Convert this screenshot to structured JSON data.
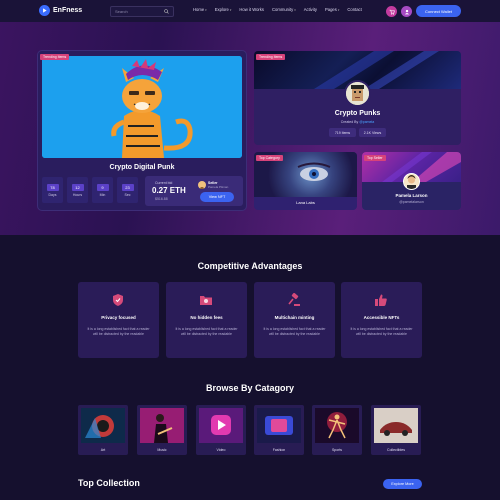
{
  "nav": {
    "brand": "EnFness",
    "search_placeholder": "Search",
    "menu": [
      "Home",
      "Explore",
      "How it Works",
      "Community",
      "Activity",
      "Pages",
      "Contact"
    ],
    "connect_label": "Connect Wallet"
  },
  "hero": {
    "main_card": {
      "tag": "Trending Items",
      "title": "Crypto Digital Punk",
      "timer": [
        {
          "value": "78",
          "label": "Days"
        },
        {
          "value": "12",
          "label": "Hours"
        },
        {
          "value": "9",
          "label": "Min"
        },
        {
          "value": "23",
          "label": "Sec"
        }
      ],
      "bid_label": "Current bid",
      "bid_value": "0.27 ETH",
      "bid_usd": "$516.88",
      "seller_role": "Seller",
      "seller_name": "Pamela Pitman",
      "view_label": "View NFT"
    },
    "punks_card": {
      "tag": "Trending Items",
      "title": "Crypto Punks",
      "creator_prefix": "Created By",
      "creator_name": "@pamela",
      "items": "719 Items",
      "views": "2.1K Views"
    },
    "lana_card": {
      "tag": "Top Category",
      "name": "Lana Labs"
    },
    "pamela_card": {
      "tag": "Top Seller",
      "name": "Pamela Larson",
      "handle": "@pamelalarson"
    }
  },
  "advantages": {
    "title": "Competitive Advantages",
    "items": [
      {
        "title": "Privacy focused",
        "desc": "It is a long established fact that a reader will be distracted by the readable"
      },
      {
        "title": "No hidden fees",
        "desc": "It is a long established fact that a reader will be distracted by the readable"
      },
      {
        "title": "Multichain minting",
        "desc": "It is a long established fact that a reader will be distracted by the readable"
      },
      {
        "title": "Accessible NFTs",
        "desc": "It is a long established fact that a reader will be distracted by the readable"
      }
    ]
  },
  "categories": {
    "title": "Browse By Catagory",
    "items": [
      "Art",
      "Music",
      "Video",
      "Fashion",
      "Sports",
      "Collectibles"
    ]
  },
  "top_collection": {
    "title": "Top Collection",
    "explore_label": "Explore More"
  },
  "colors": {
    "accent": "#3b63f0",
    "background": "#15102e",
    "tag_pink": "#d6437a"
  }
}
